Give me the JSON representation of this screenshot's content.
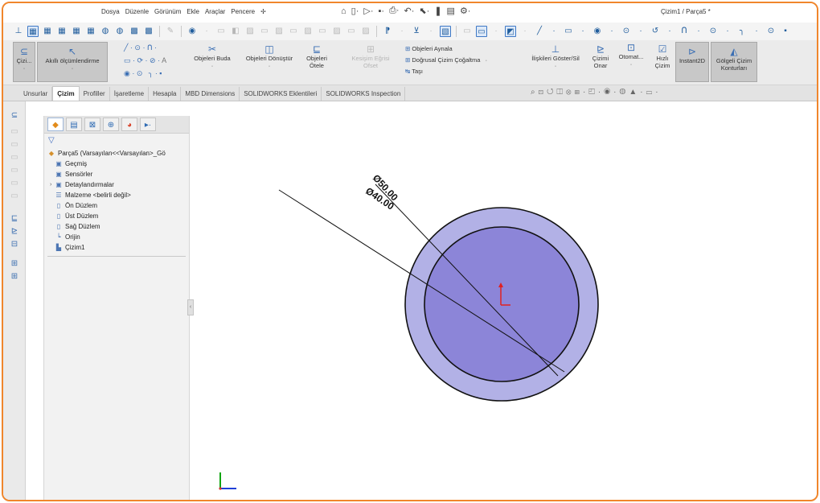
{
  "menu": {
    "items": [
      "Dosya",
      "Düzenle",
      "Görünüm",
      "Ekle",
      "Araçlar",
      "Pencere"
    ],
    "pin_icon": "pin-icon"
  },
  "window": {
    "title": "Çizim1 / Parça5 *"
  },
  "ribbon": {
    "cizim_cikis": "Çizi...",
    "akilli_olcumlendirme": "Akıllı ölçümlendirme",
    "objeleri_buda": "Objeleri Buda",
    "objeleri_donustur": "Objeleri Dönüştür",
    "objeleri_otele": "Objeleri Ötele",
    "kesisim_egrisi": "Kesişim Eğrisi",
    "kesisim_egrisi_sub": "Ofset",
    "objeleri_aynala": "Objeleri Aynala",
    "dogrusal_cizim": "Doğrusal Çizim Çoğaltma",
    "tasi": "Taşı",
    "iliskileri": "İlişkileri Göster/Sil",
    "cizimi_onar": "Çizimi Onar",
    "otomatik": "Otomat...",
    "hizli_cizim": "Hızlı Çizim",
    "instant2d": "Instant2D",
    "golgeli": "Gölgeli Çizim Konturları"
  },
  "tabs": [
    "Unsurlar",
    "Çizim",
    "Profiller",
    "İşaretleme",
    "Hesapla",
    "MBD Dimensions",
    "SOLIDWORKS Eklentileri",
    "SOLIDWORKS Inspection"
  ],
  "active_tab": "Çizim",
  "tree": {
    "root": "Parça5  (Varsayılan<<Varsayılan>_Gö",
    "items": [
      "Geçmiş",
      "Sensörler",
      "Detaylandırmalar",
      "Malzeme <belirli değil>",
      "Ön Düzlem",
      "Üst Düzlem",
      "Sağ Düzlem",
      "Orijin",
      "Çizim1"
    ]
  },
  "dimensions": {
    "outer": "Ø50.00",
    "inner": "Ø40.00"
  },
  "colors": {
    "accent_border": "#f0862c",
    "outer_ring": "#b2b1e6",
    "inner_disk": "#8c85d8",
    "origin_red": "#e02020",
    "axis_green": "#11a511",
    "axis_blue": "#1e3fd8"
  }
}
